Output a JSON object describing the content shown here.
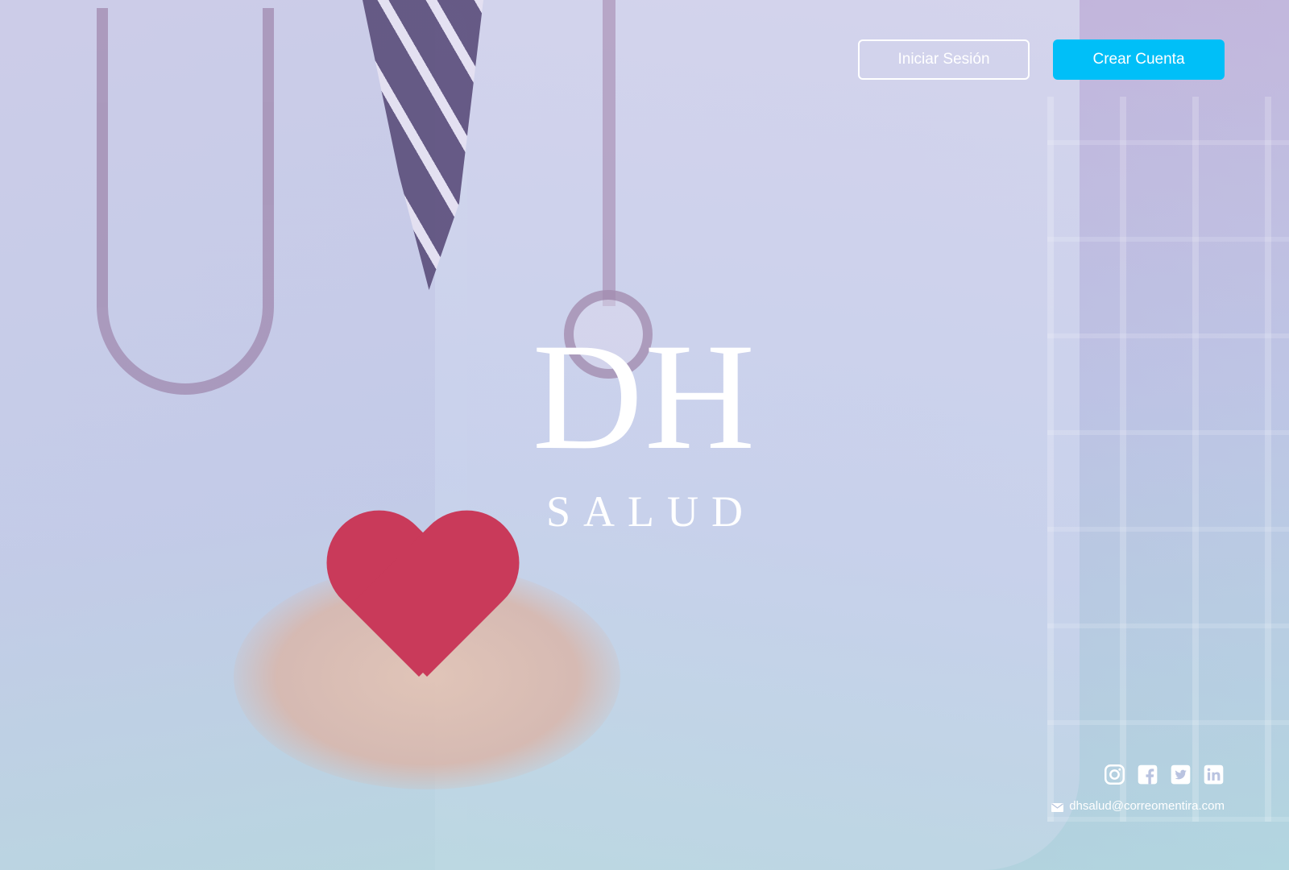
{
  "header": {
    "login_label": "Iniciar Sesión",
    "signup_label": "Crear Cuenta"
  },
  "logo": {
    "mark": "DH",
    "wordmark": "SALUD"
  },
  "footer": {
    "socials": [
      {
        "icon": "instagram-icon"
      },
      {
        "icon": "facebook-icon"
      },
      {
        "icon": "twitter-icon"
      },
      {
        "icon": "linkedin-icon"
      }
    ],
    "email": "dhsalud@correomentira.com"
  },
  "colors": {
    "accent": "#00bff8",
    "text": "#ffffff"
  }
}
